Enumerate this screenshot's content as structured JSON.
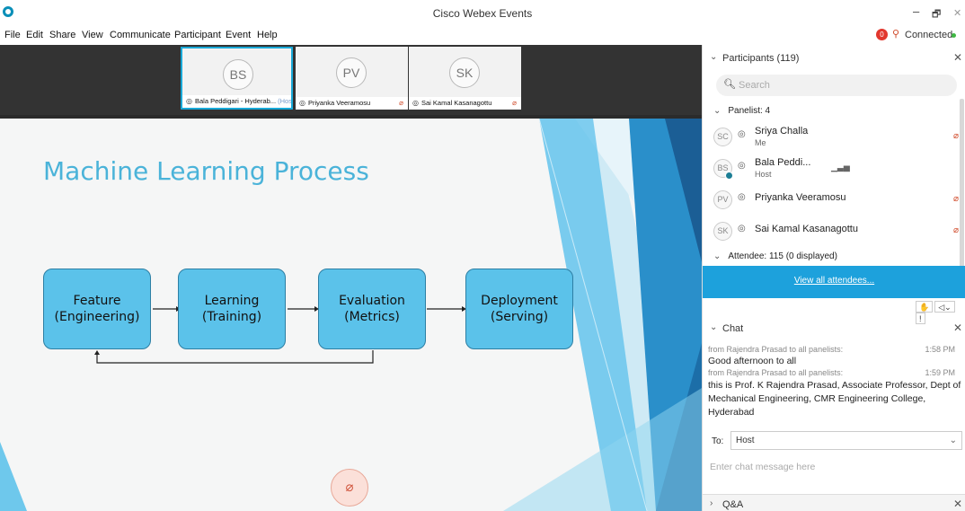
{
  "window": {
    "title": "Cisco Webex Events",
    "minimize_glyph": "–",
    "restore_glyph": "🗗",
    "close_glyph": "✕"
  },
  "menu": {
    "file": "File",
    "edit": "Edit",
    "share": "Share",
    "view": "View",
    "communicate": "Communicate",
    "participant": "Participant",
    "event": "Event",
    "help": "Help"
  },
  "connection": {
    "badge": "0",
    "status": "Connected"
  },
  "video_strip": {
    "tiles": [
      {
        "initials": "BS",
        "name": "Bala Peddigari - Hyderab...",
        "host_tag": "(Host)",
        "active": true
      },
      {
        "initials": "PV",
        "name": "Priyanka Veeramosu",
        "muted": true
      },
      {
        "initials": "SK",
        "name": "Sai Kamal Kasanagottu",
        "muted": true
      }
    ]
  },
  "slide": {
    "title": "Machine Learning Process",
    "boxes": [
      "Feature\n(Engineering)",
      "Learning\n(Training)",
      "Evaluation\n(Metrics)",
      "Deployment\n(Serving)"
    ],
    "box_color": "#5bc2ea",
    "title_color": "#4ab3d9"
  },
  "participants": {
    "title": "Participants (119)",
    "search_placeholder": "Search",
    "panelist_label": "Panelist: 4",
    "panelists": [
      {
        "initials": "SC",
        "name": "Sriya Challa",
        "role": "Me",
        "muted": true
      },
      {
        "initials": "BS",
        "name": "Bala Peddi...",
        "role": "Host",
        "muted": false
      },
      {
        "initials": "PV",
        "name": "Priyanka Veeramosu",
        "role": "",
        "muted": true
      },
      {
        "initials": "SK",
        "name": "Sai Kamal Kasanagottu",
        "role": "",
        "muted": true
      }
    ],
    "attendee_label": "Attendee: 115 (0 displayed)",
    "view_all_link": "View all attendees...",
    "accent_color": "#1da1dc"
  },
  "chat": {
    "title": "Chat",
    "messages": [
      {
        "from": "from Rajendra Prasad to all panelists:",
        "time": "1:58 PM",
        "text": "Good afternoon to all"
      },
      {
        "from": "from Rajendra Prasad to all panelists:",
        "time": "1:59 PM",
        "text": "this is Prof. K Rajendra Prasad, Associate Professor, Dept of Mechanical Engineering, CMR Engineering College, Hyderabad"
      }
    ],
    "to_label": "To:",
    "to_value": "Host",
    "input_placeholder": "Enter chat message here"
  },
  "qa": {
    "title": "Q&A"
  }
}
